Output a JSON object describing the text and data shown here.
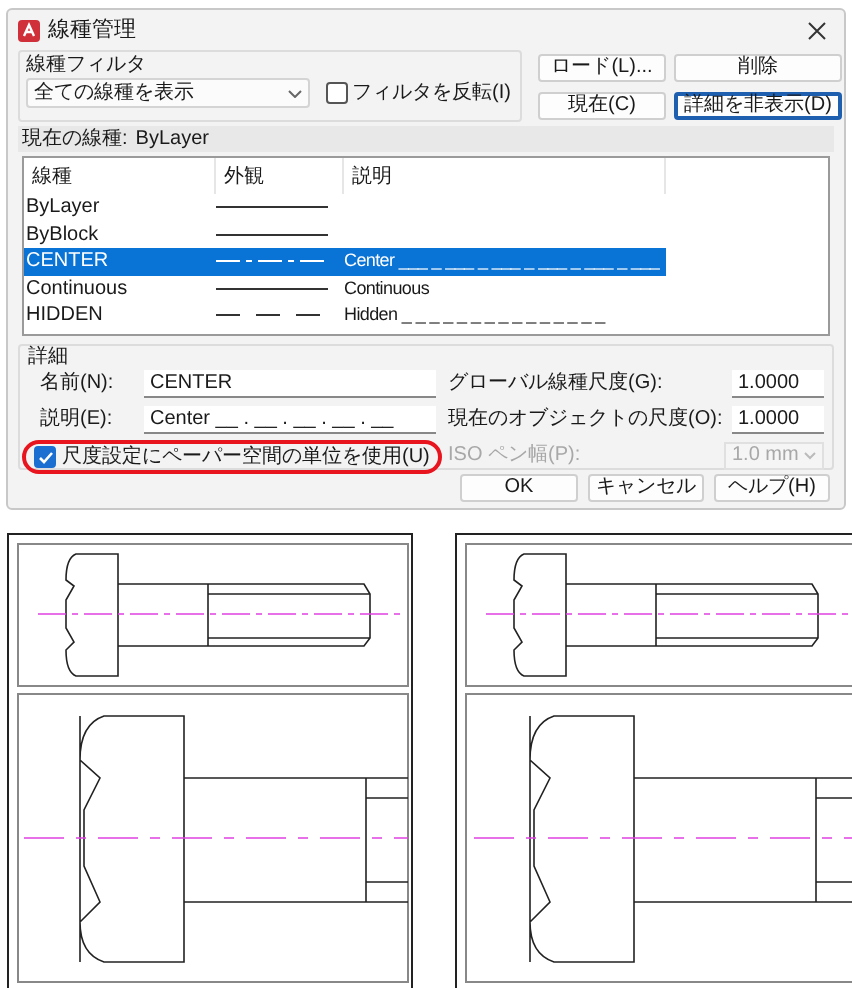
{
  "window": {
    "title": "線種管理"
  },
  "filter": {
    "label": "線種フィルタ",
    "dropdown": "全ての線種を表示",
    "invert": {
      "label": "フィルタを反転(I)",
      "checked": false
    }
  },
  "top_buttons": [
    {
      "label": "ロード(L)...",
      "focused": false
    },
    {
      "label": "削除",
      "focused": false
    },
    {
      "label": "現在(C)",
      "focused": false
    },
    {
      "label": "詳細を非表示(D)",
      "focused": true
    }
  ],
  "current": {
    "label": "現在の線種:",
    "value": "ByLayer"
  },
  "table": {
    "columns": [
      "線種",
      "外観",
      "説明"
    ],
    "rows": [
      {
        "name": "ByLayer",
        "kind": "solid",
        "selected": false
      },
      {
        "name": "ByBlock",
        "kind": "solid",
        "selected": false
      },
      {
        "name": "CENTER",
        "kind": "center",
        "description": "Center ___ _ ___ _ ___ _ ___ _ ___ _ ___",
        "selected": true
      },
      {
        "name": "Continuous",
        "kind": "solid",
        "description": "Continuous",
        "selected": false
      },
      {
        "name": "HIDDEN",
        "kind": "hidden",
        "description": "Hidden _ _ _ _ _ _ _ _ _ _ _ _ _ _ _",
        "selected": false
      }
    ]
  },
  "details": {
    "label": "詳細",
    "name": {
      "label": "名前(N):",
      "value": "CENTER"
    },
    "description": {
      "label": "説明(E):",
      "value": "Center __ . __ . __ . __ . __"
    },
    "paper_space": {
      "label": "尺度設定にペーパー空間の単位を使用(U)",
      "checked": true,
      "highlighted": true
    },
    "global_scale": {
      "label": "グローバル線種尺度(G):",
      "value": "1.0000"
    },
    "object_scale": {
      "label": "現在のオブジェクトの尺度(O):",
      "value": "1.0000"
    },
    "iso_pen": {
      "label": "ISO ペン幅(P):",
      "value": "1.0 mm",
      "disabled": true
    }
  },
  "buttons": [
    {
      "label": "OK"
    },
    {
      "label": "キャンセル"
    },
    {
      "label": "ヘルプ(H)"
    }
  ]
}
